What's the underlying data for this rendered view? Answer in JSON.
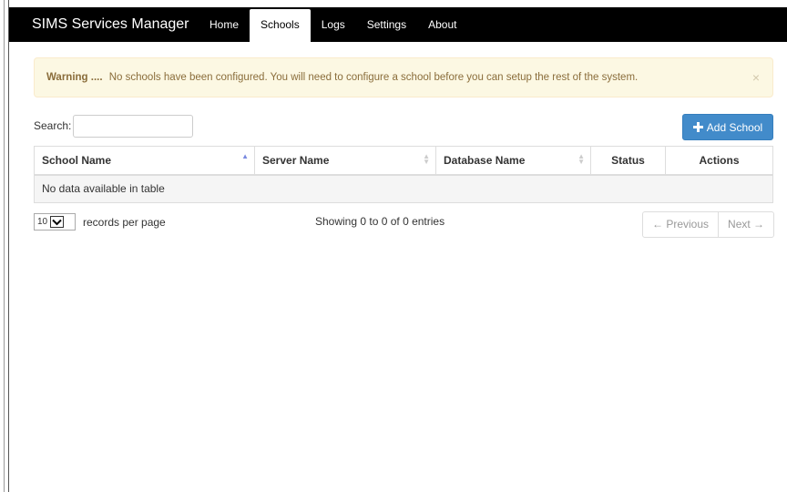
{
  "navbar": {
    "brand": "SIMS Services Manager",
    "items": [
      {
        "label": "Home"
      },
      {
        "label": "Schools"
      },
      {
        "label": "Logs"
      },
      {
        "label": "Settings"
      },
      {
        "label": "About"
      }
    ],
    "active_item": "Schools"
  },
  "alert": {
    "title": "Warning ....",
    "message": "No schools have been configured. You will need to configure a school before you can setup the rest of the system.",
    "close": "×"
  },
  "search": {
    "label": "Search:",
    "value": ""
  },
  "add_button": {
    "label": "Add School",
    "icon": "plus-icon",
    "color": "#428bca"
  },
  "table": {
    "columns": [
      "School Name",
      "Server Name",
      "Database Name",
      "Status",
      "Actions"
    ],
    "empty_message": "No data available in table"
  },
  "pagination": {
    "page_length": "10",
    "per_page_label": "records per page",
    "info": "Showing 0 to 0 of 0 entries",
    "previous": "← Previous",
    "next": "Next →"
  }
}
